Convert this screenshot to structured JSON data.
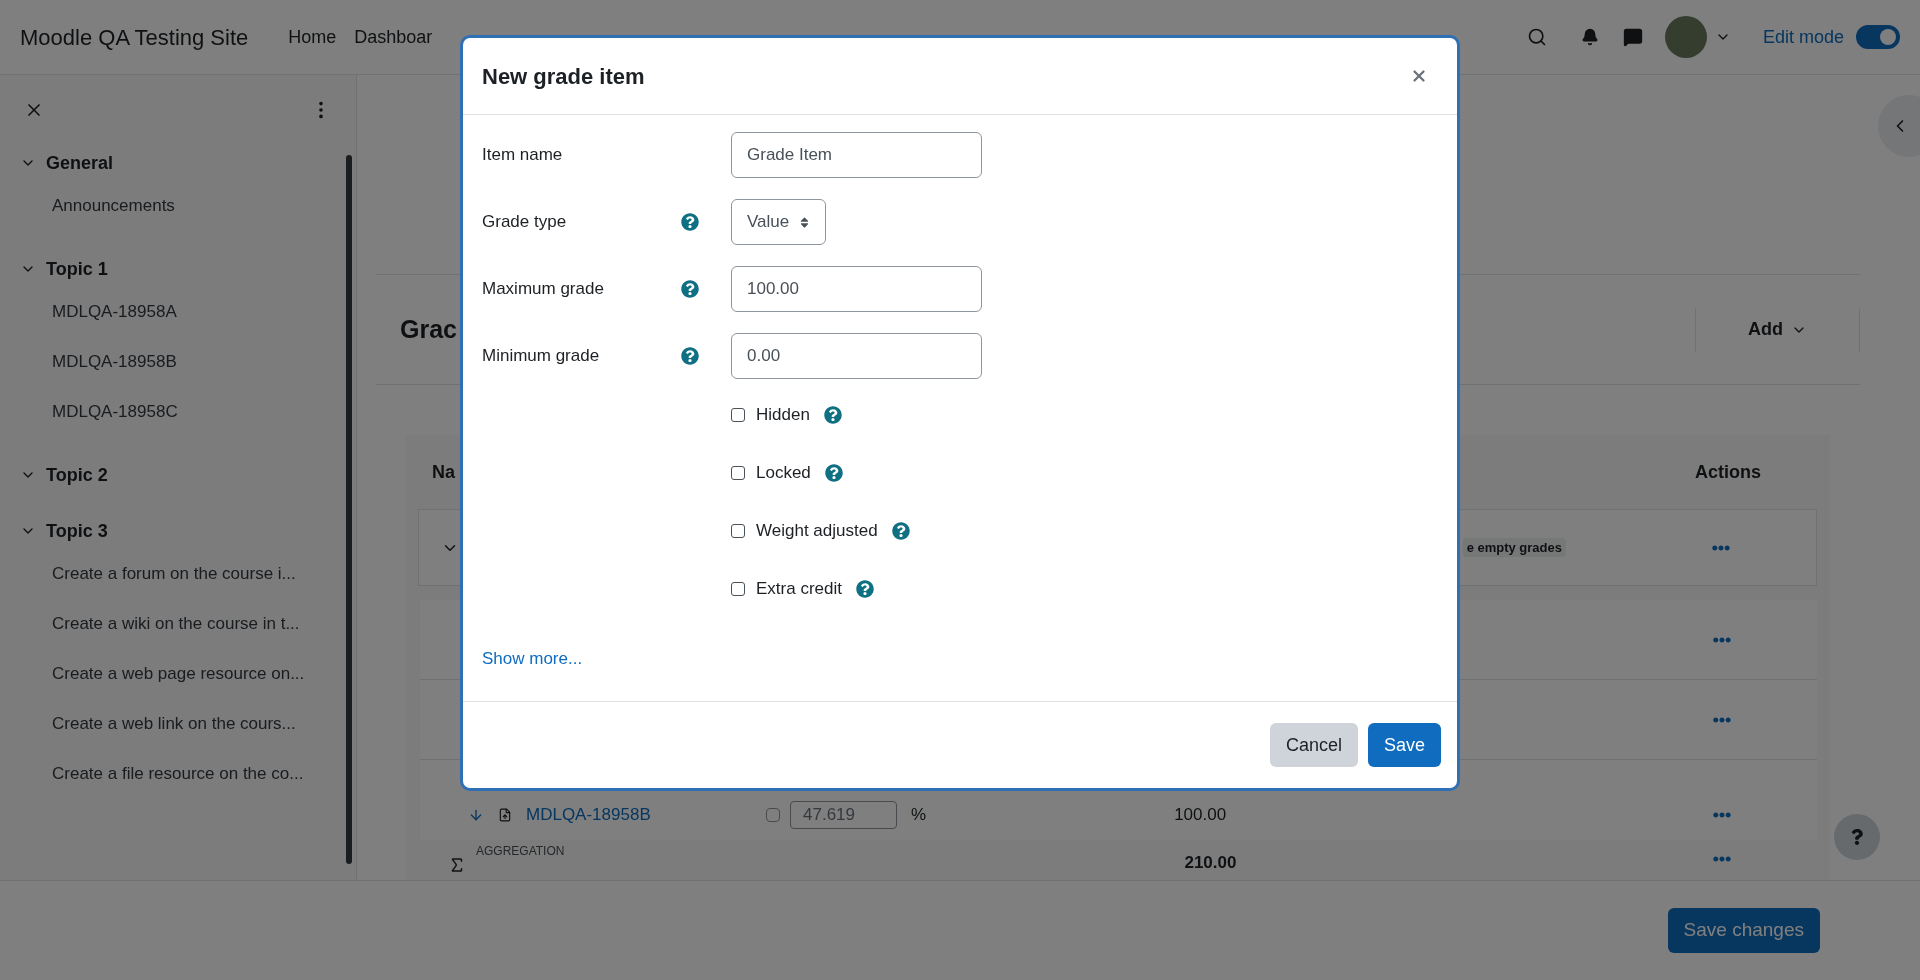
{
  "navbar": {
    "site_name": "Moodle QA Testing Site",
    "links": [
      "Home",
      "Dashboar"
    ],
    "edit_mode": {
      "label": "Edit mode",
      "on": true
    }
  },
  "course_index": {
    "sections": [
      {
        "title": "General",
        "expanded": true,
        "children": [
          {
            "title": "Announcements"
          }
        ]
      },
      {
        "title": "Topic 1",
        "expanded": true,
        "children": [
          {
            "title": "MDLQA-18958A"
          },
          {
            "title": "MDLQA-18958B"
          },
          {
            "title": "MDLQA-18958C"
          }
        ]
      },
      {
        "title": "Topic 2",
        "expanded": true
      },
      {
        "title": "Topic 3",
        "expanded": true,
        "children": [
          {
            "title": "Create a forum on the course i..."
          },
          {
            "title": "Create a wiki on the course in t..."
          },
          {
            "title": "Create a web page resource on..."
          },
          {
            "title": "Create a web link on the cours..."
          },
          {
            "title": "Create a file resource on the co..."
          }
        ]
      }
    ]
  },
  "page": {
    "heading": "Grac",
    "add_button": "Add",
    "table": {
      "columns": [
        "Na",
        "Actions"
      ],
      "rows": [
        {
          "kind": "category",
          "text": "e empty grades"
        },
        {
          "kind": "blank"
        },
        {
          "kind": "blank"
        },
        {
          "kind": "item",
          "name": "MDLQA-18958B",
          "weight_override": false,
          "weight": "47.619",
          "percent": "%",
          "max_grade": "100.00"
        },
        {
          "kind": "aggregation",
          "label": "AGGREGATION",
          "total": "210.00"
        }
      ]
    }
  },
  "footer": {
    "save_button": "Save changes"
  },
  "modal": {
    "title": "New grade item",
    "fields": [
      {
        "kind": "text",
        "label": "Item name",
        "help": false,
        "value": "Grade Item"
      },
      {
        "kind": "select",
        "label": "Grade type",
        "help": true,
        "value": "Value"
      },
      {
        "kind": "text",
        "label": "Maximum grade",
        "help": true,
        "value": "100.00"
      },
      {
        "kind": "text",
        "label": "Minimum grade",
        "help": true,
        "value": "0.00"
      }
    ],
    "checkboxes": [
      {
        "label": "Hidden",
        "checked": false
      },
      {
        "label": "Locked",
        "checked": false
      },
      {
        "label": "Weight adjusted",
        "checked": false
      },
      {
        "label": "Extra credit",
        "checked": false
      }
    ],
    "show_more": "Show more...",
    "buttons": [
      {
        "label": "Cancel",
        "kind": "secondary"
      },
      {
        "label": "Save",
        "kind": "primary"
      }
    ]
  }
}
